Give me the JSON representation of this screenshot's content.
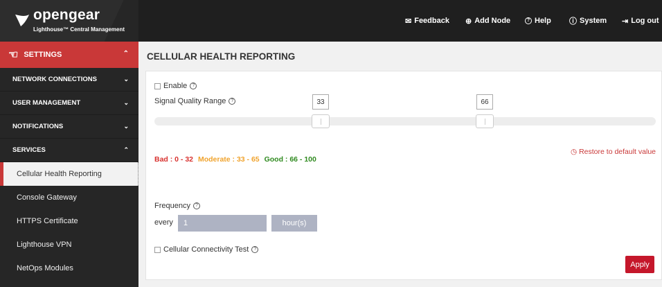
{
  "header": {
    "brand": "opengear",
    "brand_sub": "Lighthouse™ Central Management",
    "nav": [
      {
        "label": "Feedback",
        "icon": "✉"
      },
      {
        "label": "Add Node",
        "icon": "⊕"
      },
      {
        "label": "Help",
        "icon": "?"
      },
      {
        "label": "System",
        "icon": "ⓘ"
      },
      {
        "label": "Log out",
        "icon": "⇥"
      }
    ]
  },
  "sidebar": {
    "settings_label": "SETTINGS",
    "sections": [
      {
        "label": "NETWORK CONNECTIONS"
      },
      {
        "label": "USER MANAGEMENT"
      },
      {
        "label": "NOTIFICATIONS"
      },
      {
        "label": "SERVICES"
      }
    ],
    "items": [
      {
        "label": "Cellular Health Reporting"
      },
      {
        "label": "Console Gateway"
      },
      {
        "label": "HTTPS Certificate"
      },
      {
        "label": "Lighthouse VPN"
      },
      {
        "label": "NetOps Modules"
      }
    ]
  },
  "main": {
    "title": "CELLULAR HEALTH REPORTING",
    "enable_label": "Enable",
    "signal_quality_label": "Signal Quality Range",
    "range_low": "33",
    "range_high": "66",
    "legend": {
      "bad": "Bad : 0 - 32",
      "moderate": "Moderate : 33 - 65",
      "good": "Good : 66 - 100"
    },
    "restore_label": "Restore to default value",
    "frequency_label": "Frequency",
    "every_label": "every",
    "frequency_value": "1",
    "frequency_unit": "hour(s)",
    "connectivity_label": "Cellular Connectivity Test",
    "apply_label": "Apply"
  },
  "colors": {
    "accent": "#c93838",
    "bad": "#d8322f",
    "moderate": "#f0a32d",
    "good": "#2f8a1f"
  }
}
